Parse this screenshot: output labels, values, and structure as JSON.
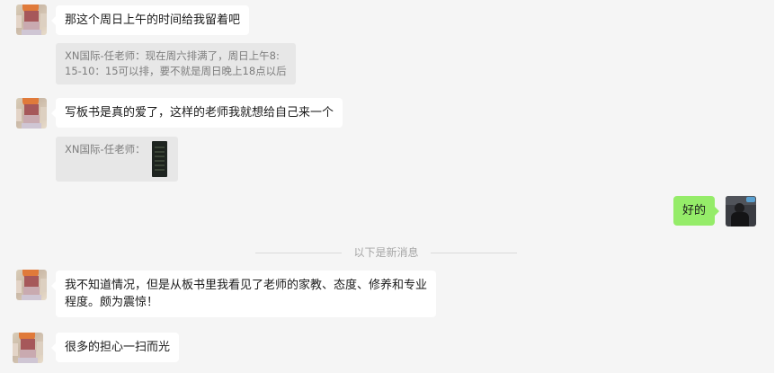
{
  "messages": [
    {
      "text": "那这个周日上午的时间给我留着吧"
    },
    {
      "quote_lines": [
        "XN国际-任老师：现在周六排满了，周日上午8:",
        "15-10：15可以排，要不就是周日晚上18点以后"
      ]
    },
    {
      "text": "写板书是真的爱了，这样的老师我就想给自己来一个"
    },
    {
      "quote_lines": [
        "XN国际-任老师："
      ]
    },
    {
      "text": "好的"
    },
    {
      "text_lines": [
        "我不知道情况，但是从板书里我看见了老师的家教、态度、修养和专业",
        "程度。颇为震惊！"
      ]
    },
    {
      "text": "很多的担心一扫而光"
    }
  ],
  "divider": {
    "label": "以下是新消息"
  },
  "colors": {
    "background": "#f5f5f5",
    "incoming_bubble": "#ffffff",
    "outgoing_bubble": "#95ec69",
    "quote_bg": "#e7e7e7"
  }
}
